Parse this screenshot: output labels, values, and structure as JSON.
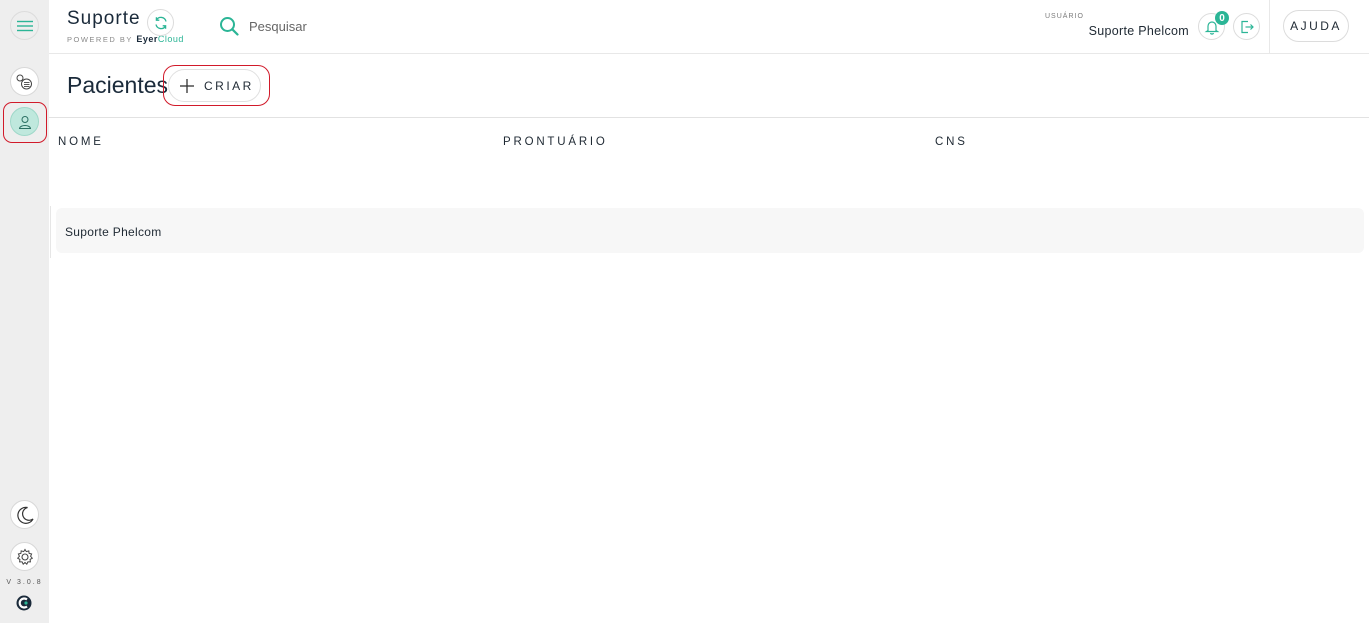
{
  "sidebar": {
    "version": "V 3.0.8",
    "items": [
      {
        "name": "menu",
        "icon": "hamburger-icon"
      },
      {
        "name": "exams",
        "icon": "exams-list-icon"
      },
      {
        "name": "patients",
        "icon": "patient-icon",
        "active": true
      },
      {
        "name": "theme",
        "icon": "moon-icon"
      },
      {
        "name": "settings",
        "icon": "gear-icon"
      }
    ]
  },
  "header": {
    "brand_title": "Suporte",
    "brand_powered": "POWERED BY",
    "brand_eyer": "Eyer",
    "brand_cloud": "Cloud",
    "search_placeholder": "Pesquisar",
    "user_caption": "USUÁRIO",
    "user_name": "Suporte Phelcom",
    "notifications_count": "0",
    "help_label": "AJUDA"
  },
  "page": {
    "title": "Pacientes",
    "create_label": "CRIAR"
  },
  "table": {
    "columns": [
      "NOME",
      "PRONTUÁRIO",
      "CNS"
    ],
    "rows": [
      {
        "nome": "Suporte Phelcom",
        "prontuario": "",
        "cns": ""
      }
    ]
  },
  "colors": {
    "accent": "#2bb596",
    "active_sidebar": "#bfe8dd",
    "highlight_border": "#d11a2a",
    "sidebar_bg": "#eeeeee"
  }
}
